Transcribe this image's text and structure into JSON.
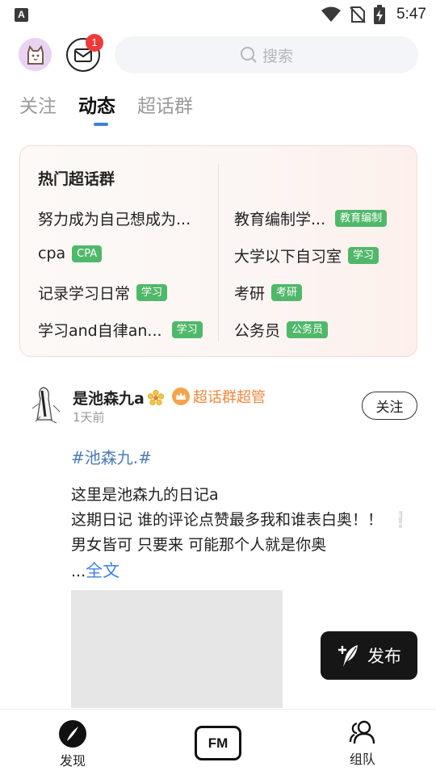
{
  "status_bar": {
    "app_icon_letter": "A",
    "time": "5:47",
    "icons": [
      "wifi-icon",
      "no-sim-icon",
      "battery-charging-icon"
    ]
  },
  "header": {
    "avatar_icon": "cat-avatar-icon",
    "mail_icon": "mail-icon",
    "mail_badge": "1",
    "search_placeholder": "搜索"
  },
  "tabs": [
    {
      "label": "关注",
      "active": false
    },
    {
      "label": "动态",
      "active": true
    },
    {
      "label": "超话群",
      "active": false
    }
  ],
  "hot_groups": {
    "title": "热门超话群",
    "left": [
      {
        "name": "努力成为自己想成为...",
        "tag": ""
      },
      {
        "name": "cpa",
        "tag": "CPA"
      },
      {
        "name": "记录学习日常",
        "tag": "学习"
      },
      {
        "name": "学习and自律an...",
        "tag": "学习"
      }
    ],
    "right": [
      {
        "name": "教育编制学...",
        "tag": "教育编制"
      },
      {
        "name": "大学以下自习室",
        "tag": "学习"
      },
      {
        "name": "考研",
        "tag": "考研"
      },
      {
        "name": "公务员",
        "tag": "公务员"
      }
    ],
    "tag_color": "#50b86a"
  },
  "post": {
    "author": "是池森九a",
    "role_badge": "超话群超管",
    "time": "1天前",
    "follow_label": "关注",
    "topic": "#池森九.#",
    "lines": [
      "这里是池森九的日记a",
      "这期日记 谁的评论点赞最多我和谁表白奥！！",
      "男女皆可  只要来 可能那个人就是你奥"
    ],
    "exclamation": "❕",
    "ellipsis": "...",
    "full_text_label": "全文"
  },
  "publish_button": {
    "label": "发布"
  },
  "bottom_nav": {
    "discover": "发现",
    "fm": "FM",
    "team": "组队"
  },
  "colors": {
    "accent_blue": "#3d80e0",
    "topic_blue": "#4a7cb8",
    "admin_orange": "#f0873a",
    "badge_red": "#f03a3a"
  }
}
